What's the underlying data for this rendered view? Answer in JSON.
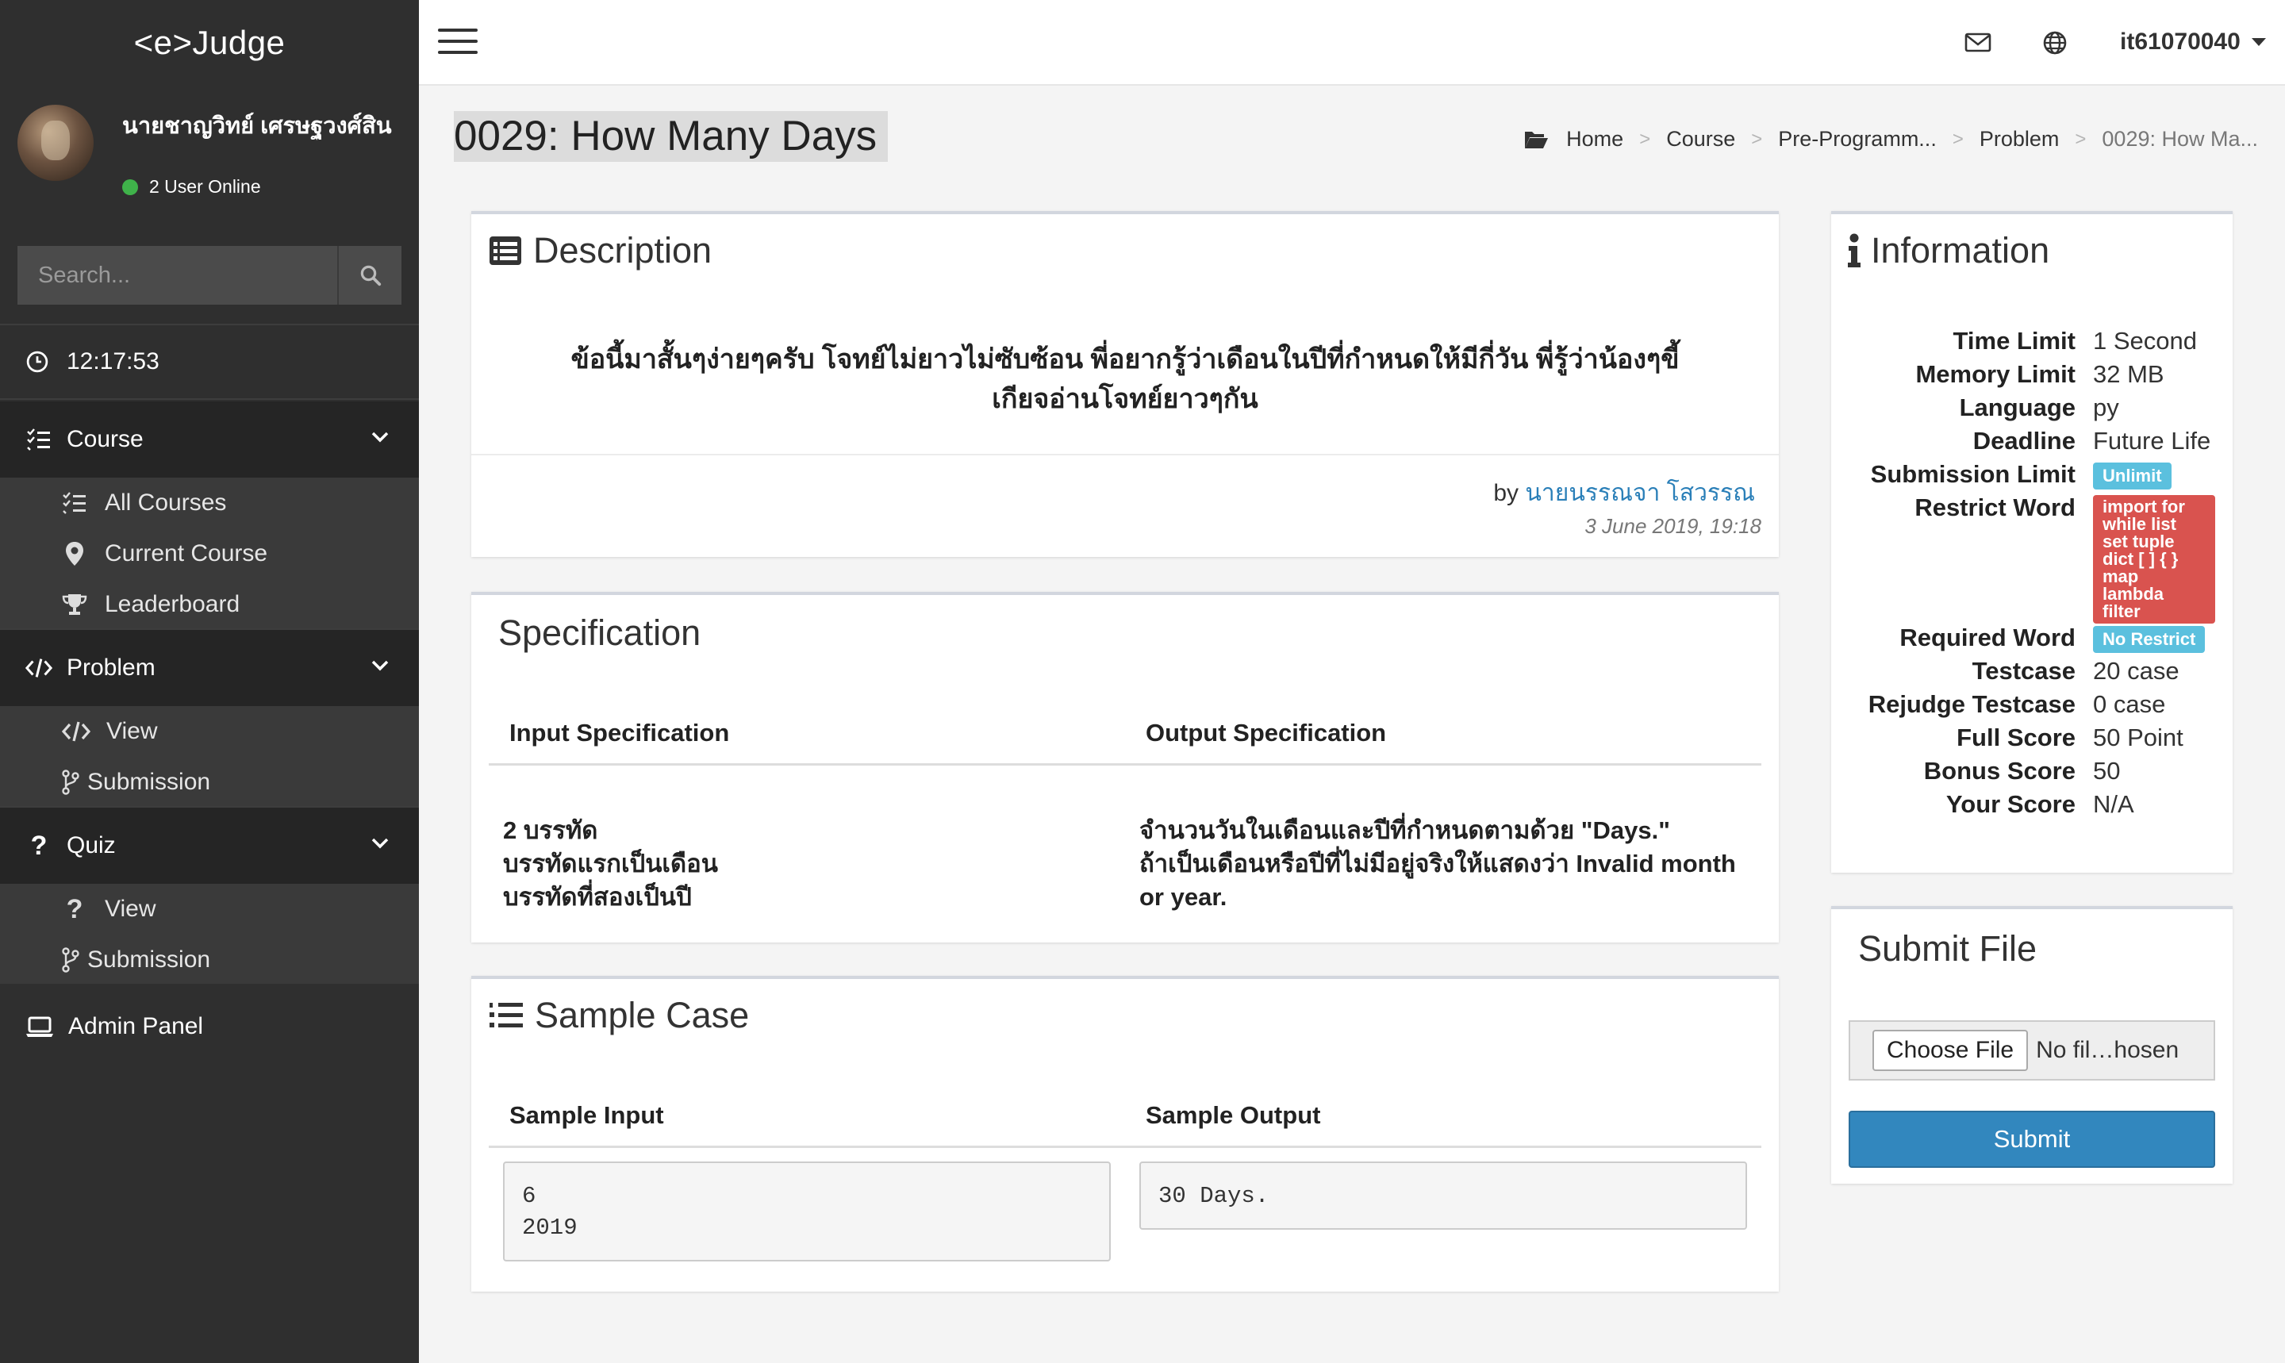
{
  "app": {
    "brand": "<e>Judge"
  },
  "user": {
    "name": "นายชาญวิทย์ เศรษฐวงศ์สิน",
    "online": "2 User Online",
    "username": "it61070040"
  },
  "search": {
    "placeholder": "Search..."
  },
  "clock": "12:17:53",
  "nav": {
    "course": {
      "label": "Course",
      "items": [
        "All Courses",
        "Current Course",
        "Leaderboard"
      ]
    },
    "problem": {
      "label": "Problem",
      "items": [
        "View",
        "Submission"
      ]
    },
    "quiz": {
      "label": "Quiz",
      "items": [
        "View",
        "Submission"
      ]
    },
    "admin": "Admin Panel"
  },
  "page": {
    "title": "0029: How Many Days"
  },
  "breadcrumb": [
    "Home",
    "Course",
    "Pre-Programm...",
    "Problem",
    "0029: How Ma..."
  ],
  "description": {
    "title": "Description",
    "text_line1": "ข้อนี้มาสั้นๆง่ายๆครับ โจทย์ไม่ยาวไม่ซับซ้อน พี่อยากรู้ว่าเดือนในปีที่กำหนดให้มีกี่วัน พี่รู้ว่าน้องๆขี้",
    "text_line2": "เกียจอ่านโจทย์ยาวๆกัน",
    "by_label": "by",
    "author": "นายนรรณจา โสวรรณ",
    "date": "3 June 2019, 19:18"
  },
  "specification": {
    "title": "Specification",
    "input_header": "Input Specification",
    "output_header": "Output Specification",
    "input_lines": [
      "2 บรรทัด",
      "บรรทัดแรกเป็นเดือน",
      "บรรทัดที่สองเป็นปี"
    ],
    "output_lines": [
      "จำนวนวันในเดือนและปีที่กำหนดตามด้วย \"Days.\"",
      "ถ้าเป็นเดือนหรือปีที่ไม่มีอยู่จริงให้แสดงว่า Invalid month",
      "or year."
    ]
  },
  "sample": {
    "title": "Sample Case",
    "input_header": "Sample Input",
    "output_header": "Sample Output",
    "input": "6\n2019",
    "output": "30 Days."
  },
  "information": {
    "title": "Information",
    "rows": [
      {
        "label": "Time Limit",
        "value": "1 Second"
      },
      {
        "label": "Memory Limit",
        "value": "32 MB"
      },
      {
        "label": "Language",
        "value": "py"
      },
      {
        "label": "Deadline",
        "value": "Future Life"
      },
      {
        "label": "Submission Limit",
        "value": "Unlimit"
      },
      {
        "label": "Restrict Word",
        "value": "import for while list set tuple dict [ ] { } map lambda filter"
      },
      {
        "label": "Required Word",
        "value": "No Restrict"
      },
      {
        "label": "Testcase",
        "value": "20 case"
      },
      {
        "label": "Rejudge Testcase",
        "value": "0 case"
      },
      {
        "label": "Full Score",
        "value": "50 Point"
      },
      {
        "label": "Bonus Score",
        "value": "50"
      },
      {
        "label": "Your Score",
        "value": "N/A"
      }
    ],
    "restrict_lines": [
      "import for",
      "while list",
      "set tuple",
      "dict [ ] { }",
      "map",
      "lambda",
      "filter"
    ]
  },
  "submit": {
    "title": "Submit File",
    "choose": "Choose File",
    "no_file": "No fil…hosen",
    "button": "Submit"
  },
  "colors": {
    "sidebar": "#2f2f2f",
    "accent": "#3287be",
    "label_info": "#5bc0de",
    "label_danger": "#d9534f",
    "link": "#2a7fb8"
  }
}
